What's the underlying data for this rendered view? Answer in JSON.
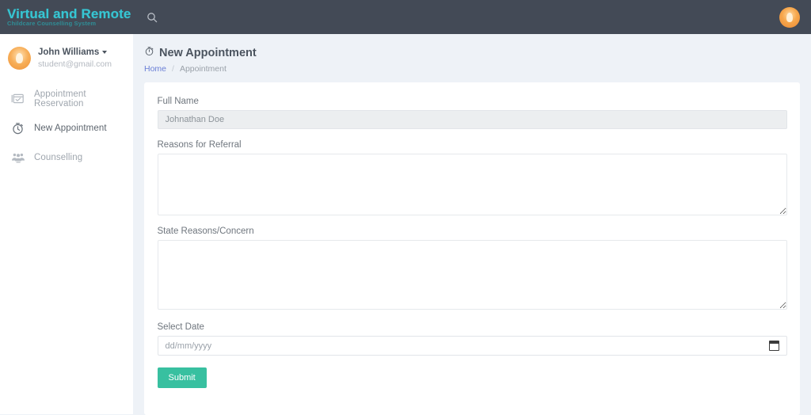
{
  "navbar": {
    "brand_title": "Virtual and Remote",
    "brand_subtitle": "Childcare Counselling System",
    "search_icon": "search-icon",
    "avatar_icon": "user-avatar-bulb-icon"
  },
  "sidebar": {
    "user": {
      "name": "John Williams",
      "email": "student@gmail.com",
      "avatar_icon": "user-avatar-bulb-icon",
      "caret_icon": "chevron-down-icon"
    },
    "items": [
      {
        "label": "Appointment Reservation",
        "icon": "calendar-card-icon",
        "active": false
      },
      {
        "label": "New Appointment",
        "icon": "stopwatch-icon",
        "active": true
      },
      {
        "label": "Counselling",
        "icon": "people-group-icon",
        "active": false
      }
    ]
  },
  "page": {
    "title": "New Appointment",
    "title_icon": "stopwatch-icon",
    "breadcrumb": {
      "home": "Home",
      "separator": "/",
      "current": "Appointment"
    }
  },
  "form": {
    "full_name": {
      "label": "Full Name",
      "value": "Johnathan Doe"
    },
    "reasons_for_referral": {
      "label": "Reasons for Referral",
      "value": "",
      "placeholder": ""
    },
    "state_reasons_concern": {
      "label": "State Reasons/Concern",
      "value": "",
      "placeholder": ""
    },
    "select_date": {
      "label": "Select Date",
      "placeholder": "dd/mm/yyyy",
      "value": "",
      "picker_icon": "calendar-picker-icon"
    },
    "submit_label": "Submit"
  },
  "colors": {
    "navbar_bg": "#434a56",
    "brand_accent": "#36c6d3",
    "page_bg": "#eef2f7",
    "submit_green": "#38c0a0",
    "link_blue": "#6a7fd6",
    "avatar_orange": "#f0943a"
  }
}
